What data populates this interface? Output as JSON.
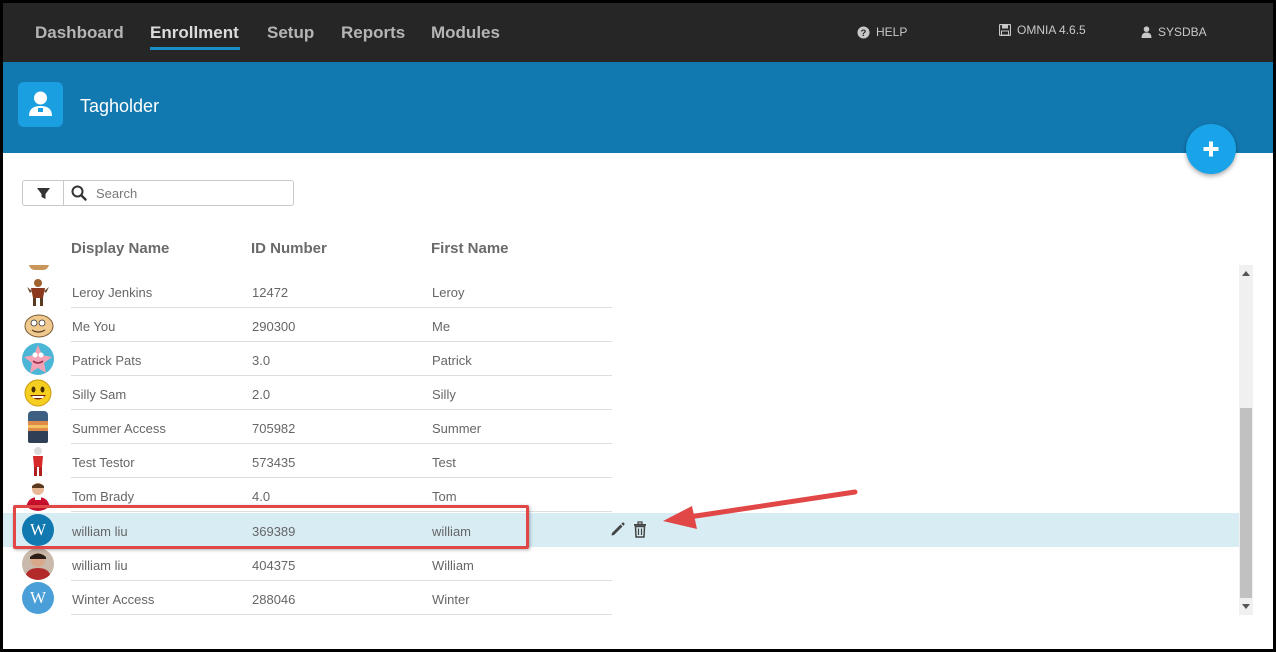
{
  "nav": {
    "items": [
      "Dashboard",
      "Enrollment",
      "Setup",
      "Reports",
      "Modules"
    ],
    "help": "HELP",
    "version": "OMNIA 4.6.5",
    "user": "SYSDBA"
  },
  "header": {
    "title": "Tagholder"
  },
  "search": {
    "placeholder": "Search",
    "value": ""
  },
  "table": {
    "columns": [
      "Display Name",
      "ID Number",
      "First Name"
    ],
    "rows": [
      {
        "avatar": "warrior-figure",
        "display_name": "Leroy Jenkins",
        "id_number": "12472",
        "first_name": "Leroy"
      },
      {
        "avatar": "cartoon-fist",
        "display_name": "Me You",
        "id_number": "290300",
        "first_name": "Me"
      },
      {
        "avatar": "patrick-star",
        "display_name": "Patrick Pats",
        "id_number": "3.0",
        "first_name": "Patrick"
      },
      {
        "avatar": "smiley-face",
        "display_name": "Silly Sam",
        "id_number": "2.0",
        "first_name": "Silly"
      },
      {
        "avatar": "sunset-beach",
        "display_name": "Summer Access",
        "id_number": "705982",
        "first_name": "Summer"
      },
      {
        "avatar": "red-figure",
        "display_name": "Test Testor",
        "id_number": "573435",
        "first_name": "Test"
      },
      {
        "avatar": "football-player",
        "display_name": "Tom Brady",
        "id_number": "4.0",
        "first_name": "Tom"
      },
      {
        "avatar": "letter-w",
        "letter": "W",
        "display_name": "william liu",
        "id_number": "369389",
        "first_name": "william",
        "selected": true
      },
      {
        "avatar": "person-photo",
        "display_name": "william liu",
        "id_number": "404375",
        "first_name": "William"
      },
      {
        "avatar": "letter-w",
        "letter": "W",
        "display_name": "Winter Access",
        "id_number": "288046",
        "first_name": "Winter"
      }
    ]
  },
  "colors": {
    "nav_bg": "#262626",
    "header_bg": "#1278b0",
    "accent": "#19a4ea",
    "selected_row": "#d7ecf3",
    "annotation": "#e24747"
  }
}
